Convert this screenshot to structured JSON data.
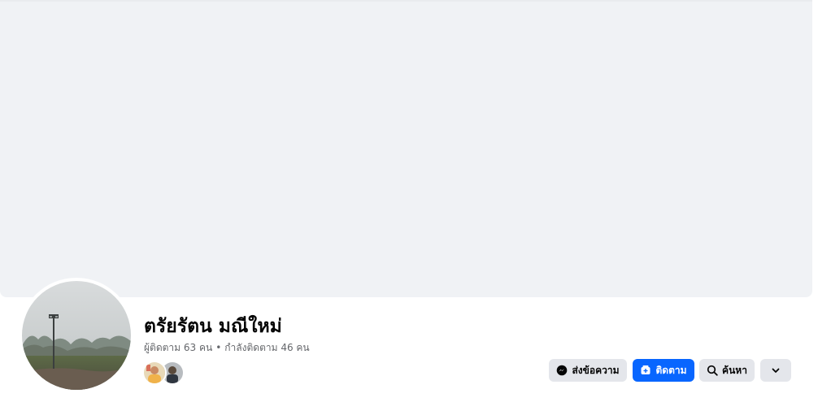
{
  "profile": {
    "name": "ตรัยรัตน มณีใหม่",
    "followers_text": "ผู้ติดตาม 63 คน",
    "separator": "•",
    "following_text": "กำลังติดตาม 46 คน"
  },
  "actions": {
    "message_label": "ส่งข้อความ",
    "follow_label": "ติดตาม",
    "search_label": "ค้นหา"
  },
  "colors": {
    "cover_bg": "#f0f2f5",
    "primary_blue": "#0866ff",
    "secondary_button_bg": "#e4e6eb",
    "name_text": "#050505",
    "secondary_text": "#65676b"
  },
  "icons": {
    "message": "messenger-icon",
    "follow": "follow-icon",
    "search": "search-icon",
    "more": "chevron-down-icon"
  }
}
